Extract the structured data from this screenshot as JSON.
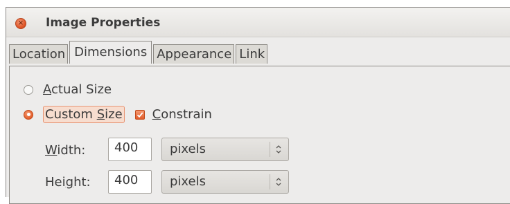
{
  "window": {
    "title": "Image Properties",
    "close_icon": "close-icon"
  },
  "tabs": [
    {
      "label": "Location",
      "active": false
    },
    {
      "label": "Dimensions",
      "active": true
    },
    {
      "label": "Appearance",
      "active": false
    },
    {
      "label": "Link",
      "active": false
    }
  ],
  "dimensions": {
    "actual_size": {
      "pre": "",
      "mnemonic": "A",
      "post": "ctual Size",
      "checked": false
    },
    "custom_size": {
      "pre": "Custom ",
      "mnemonic": "S",
      "post": "ize",
      "checked": true
    },
    "constrain": {
      "pre": "",
      "mnemonic": "C",
      "post": "onstrain",
      "checked": true
    },
    "width": {
      "label_pre": "",
      "label_mnemonic": "W",
      "label_post": "idth:",
      "value": "400",
      "unit": "pixels"
    },
    "height": {
      "label_pre": "Hei",
      "label_mnemonic": "g",
      "label_post": "ht:",
      "value": "400",
      "unit": "pixels"
    }
  },
  "colors": {
    "accent": "#e35e2b",
    "window_bg": "#edeceb",
    "text": "#3c3c3c"
  }
}
